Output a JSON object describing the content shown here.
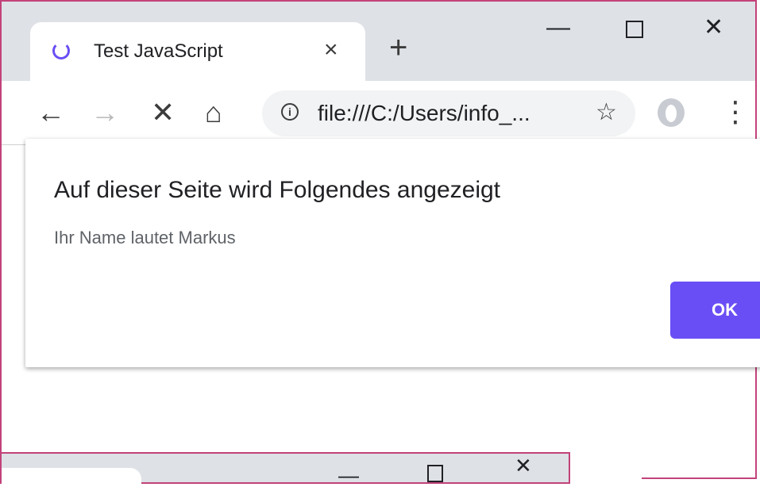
{
  "window": {
    "tab": {
      "title": "Test JavaScript",
      "close_glyph": "×"
    },
    "new_tab_glyph": "+",
    "controls": {
      "minimize": "—",
      "maximize": "",
      "close": "✕"
    }
  },
  "toolbar": {
    "back_glyph": "←",
    "forward_glyph": "→",
    "stop_glyph": "✕",
    "home_glyph": "⌂",
    "info_glyph": "i",
    "url": "file:///C:/Users/info_...",
    "star_glyph": "☆",
    "menu_glyph": "⋮"
  },
  "dialog": {
    "title": "Auf dieser Seite wird Folgendes angezeigt",
    "message": "Ihr Name lautet Markus",
    "ok_label": "OK"
  },
  "window2": {
    "controls": {
      "minimize": "—",
      "close": "✕"
    }
  },
  "colors": {
    "accent": "#6a4ef5",
    "window_border": "#c2427a",
    "tabstrip": "#dee1e6"
  }
}
